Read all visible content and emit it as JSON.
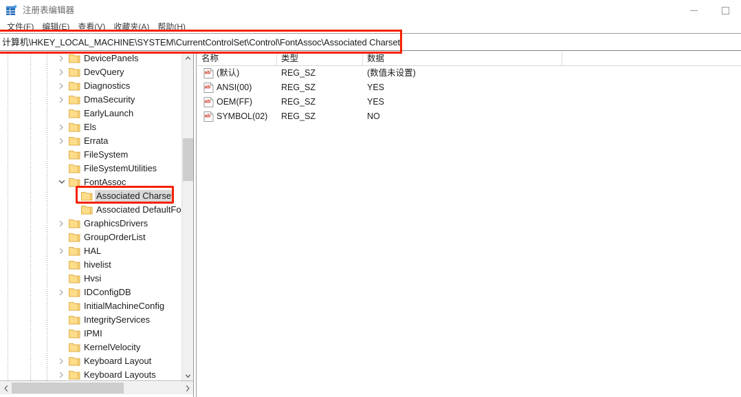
{
  "window": {
    "title": "注册表编辑器",
    "icon": "registry-editor-icon",
    "controls": [
      {
        "name": "minimize-button",
        "glyph": "minimize-icon"
      },
      {
        "name": "maximize-button",
        "glyph": "maximize-icon"
      }
    ]
  },
  "menubar": {
    "items": [
      {
        "label": "文件(F)"
      },
      {
        "label": "编辑(E)"
      },
      {
        "label": "查看(V)"
      },
      {
        "label": "收藏夹(A)"
      },
      {
        "label": "帮助(H)"
      }
    ]
  },
  "address": {
    "value": "计算机\\HKEY_LOCAL_MACHINE\\SYSTEM\\CurrentControlSet\\Control\\FontAssoc\\Associated Charset",
    "placeholder": ""
  },
  "tree": {
    "items": [
      {
        "label": "DevicePanels",
        "depth": 1,
        "expander": "collapsed",
        "selected": false
      },
      {
        "label": "DevQuery",
        "depth": 1,
        "expander": "collapsed",
        "selected": false
      },
      {
        "label": "Diagnostics",
        "depth": 1,
        "expander": "collapsed",
        "selected": false
      },
      {
        "label": "DmaSecurity",
        "depth": 1,
        "expander": "collapsed",
        "selected": false
      },
      {
        "label": "EarlyLaunch",
        "depth": 1,
        "expander": "none",
        "selected": false
      },
      {
        "label": "Els",
        "depth": 1,
        "expander": "collapsed",
        "selected": false
      },
      {
        "label": "Errata",
        "depth": 1,
        "expander": "collapsed",
        "selected": false
      },
      {
        "label": "FileSystem",
        "depth": 1,
        "expander": "none",
        "selected": false
      },
      {
        "label": "FileSystemUtilities",
        "depth": 1,
        "expander": "none",
        "selected": false
      },
      {
        "label": "FontAssoc",
        "depth": 1,
        "expander": "expanded",
        "selected": false
      },
      {
        "label": "Associated Charset",
        "depth": 2,
        "expander": "none",
        "selected": true
      },
      {
        "label": "Associated DefaultFon",
        "depth": 2,
        "expander": "none",
        "selected": false
      },
      {
        "label": "GraphicsDrivers",
        "depth": 1,
        "expander": "collapsed",
        "selected": false
      },
      {
        "label": "GroupOrderList",
        "depth": 1,
        "expander": "none",
        "selected": false
      },
      {
        "label": "HAL",
        "depth": 1,
        "expander": "collapsed",
        "selected": false
      },
      {
        "label": "hivelist",
        "depth": 1,
        "expander": "none",
        "selected": false
      },
      {
        "label": "Hvsi",
        "depth": 1,
        "expander": "none",
        "selected": false
      },
      {
        "label": "IDConfigDB",
        "depth": 1,
        "expander": "collapsed",
        "selected": false
      },
      {
        "label": "InitialMachineConfig",
        "depth": 1,
        "expander": "none",
        "selected": false
      },
      {
        "label": "IntegrityServices",
        "depth": 1,
        "expander": "none",
        "selected": false
      },
      {
        "label": "IPMI",
        "depth": 1,
        "expander": "none",
        "selected": false
      },
      {
        "label": "KernelVelocity",
        "depth": 1,
        "expander": "none",
        "selected": false
      },
      {
        "label": "Keyboard Layout",
        "depth": 1,
        "expander": "collapsed",
        "selected": false
      },
      {
        "label": "Keyboard Layouts",
        "depth": 1,
        "expander": "collapsed",
        "selected": false
      }
    ]
  },
  "list": {
    "columns": [
      {
        "label": "名称"
      },
      {
        "label": "类型"
      },
      {
        "label": "数据"
      }
    ],
    "rows": [
      {
        "icon": "string-value-icon",
        "name": "(默认)",
        "type": "REG_SZ",
        "data": "(数值未设置)"
      },
      {
        "icon": "string-value-icon",
        "name": "ANSI(00)",
        "type": "REG_SZ",
        "data": "YES"
      },
      {
        "icon": "string-value-icon",
        "name": "OEM(FF)",
        "type": "REG_SZ",
        "data": "YES"
      },
      {
        "icon": "string-value-icon",
        "name": "SYMBOL(02)",
        "type": "REG_SZ",
        "data": "NO"
      }
    ]
  },
  "scrollbars": {
    "tree_vertical": {
      "up": "▲",
      "down": "▼"
    },
    "tree_horizontal": {
      "left": "◄",
      "right": "►"
    }
  },
  "annotations": {
    "color": "#f52000",
    "boxes": [
      {
        "name": "address-bar-highlight"
      },
      {
        "name": "selected-key-highlight"
      }
    ]
  }
}
